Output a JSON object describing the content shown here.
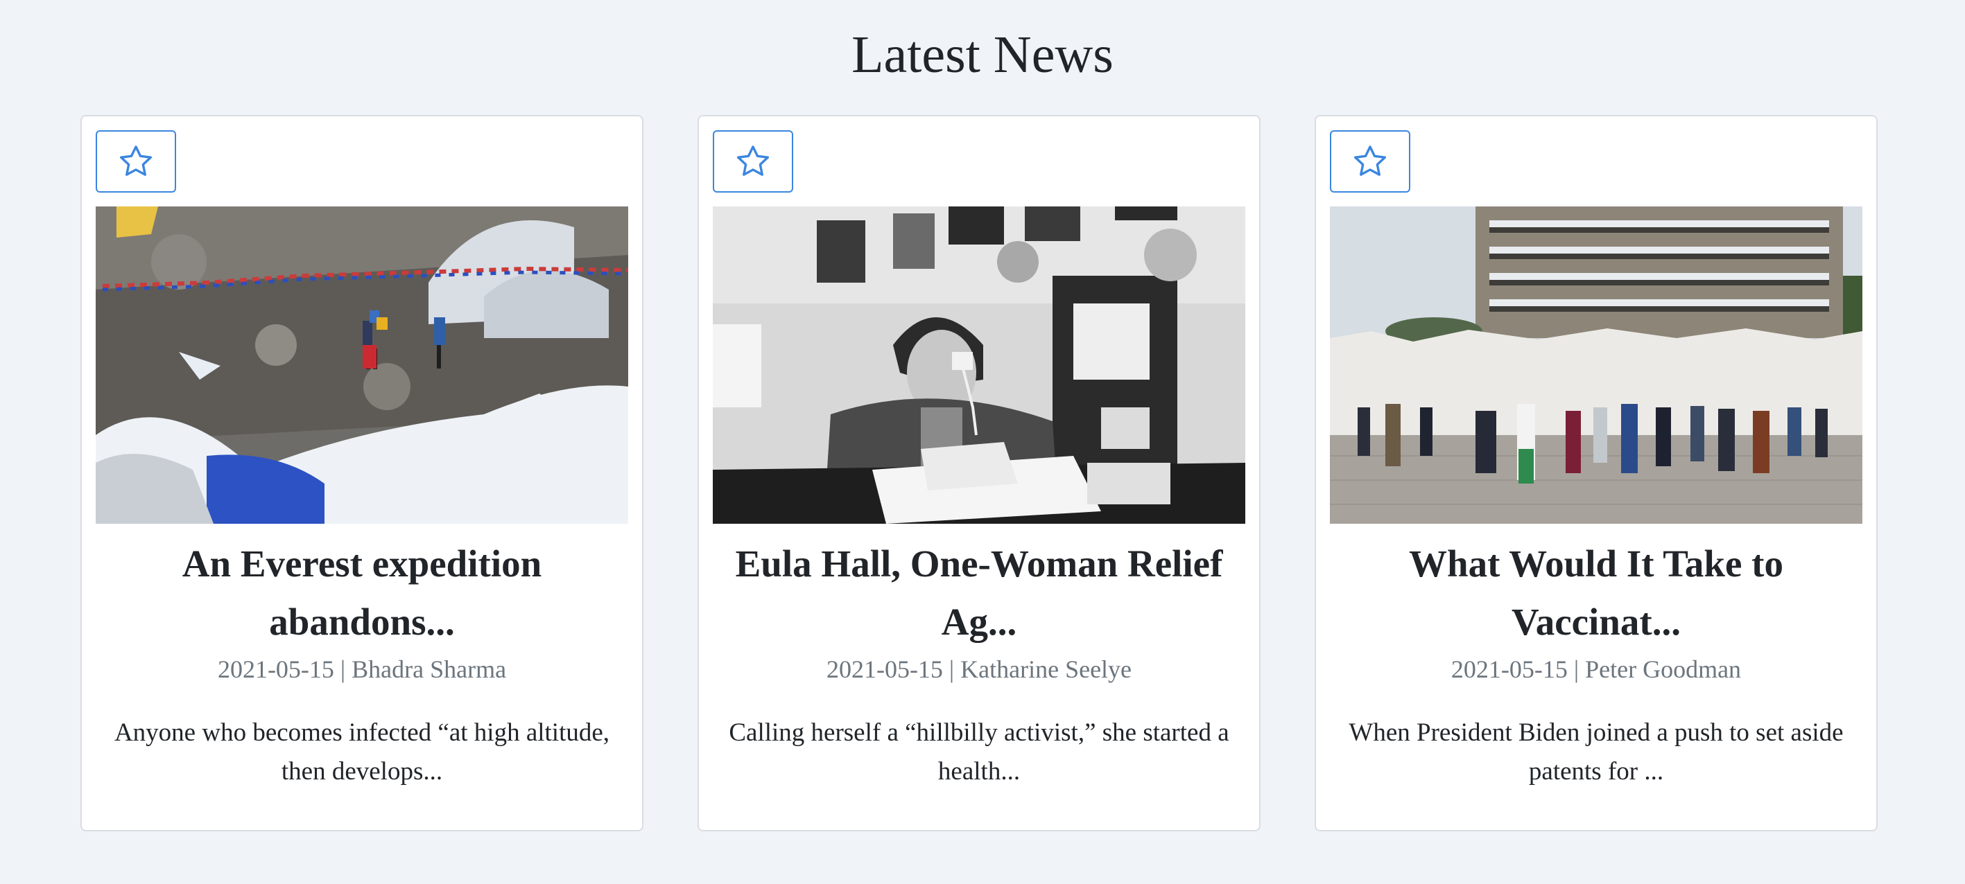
{
  "page": {
    "title": "Latest News"
  },
  "theme": {
    "accent": "#3b86e0",
    "meta_color": "#6c757d"
  },
  "favorite_icon": "star-outline-icon",
  "articles": [
    {
      "headline": "An Everest expedition abandons...",
      "date": "2021-05-15",
      "author": "Bhadra Sharma",
      "meta": "2021-05-15 | Bhadra Sharma",
      "summary": "Anyone who becomes infected “at high altitude, then develops...",
      "image": "everest-base-camp-photo"
    },
    {
      "headline": "Eula Hall, One-Woman Relief Ag...",
      "date": "2021-05-15",
      "author": "Katharine Seelye",
      "meta": "2021-05-15 | Katharine Seelye",
      "summary": "Calling herself a “hillbilly activist,” she started a health...",
      "image": "woman-on-telephone-photo"
    },
    {
      "headline": "What Would It Take to Vaccinat...",
      "date": "2021-05-15",
      "author": "Peter Goodman",
      "meta": "2021-05-15 | Peter Goodman",
      "summary": "When President Biden joined a push to set aside patents for ...",
      "image": "vaccination-queue-photo"
    }
  ]
}
